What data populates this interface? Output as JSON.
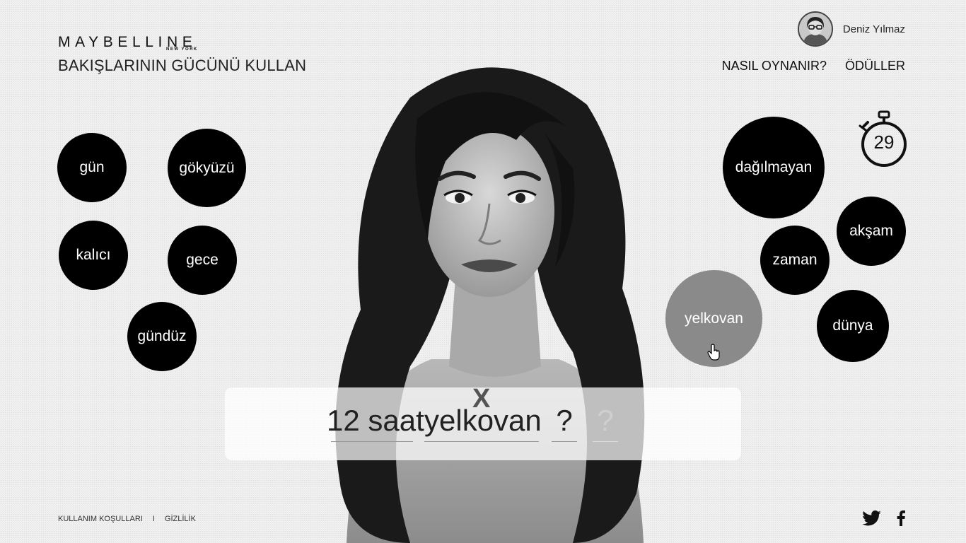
{
  "header": {
    "brand": "MAYBELLINE",
    "brand_sub": "NEW YORK",
    "tagline": "BAKIŞLARININ GÜCÜNÜ KULLAN"
  },
  "user": {
    "name": "Deniz Yılmaz",
    "avatar_icon": "user-avatar"
  },
  "nav": {
    "how_to_play": "NASIL OYNANIR?",
    "rewards": "ÖDÜLLER"
  },
  "timer": {
    "seconds": "29",
    "icon": "stopwatch-icon"
  },
  "word_bubbles_left": [
    "gün",
    "gökyüzü",
    "kalıcı",
    "gece",
    "gündüz"
  ],
  "word_bubbles_right": [
    "dağılmayan",
    "akşam",
    "zaman",
    "yelkovan",
    "dünya"
  ],
  "selected_word": "yelkovan",
  "answer": {
    "clear_label": "X",
    "slots": [
      "12 saat",
      "yelkovan",
      "?",
      "?"
    ]
  },
  "footer": {
    "terms": "KULLANIM KOŞULLARI",
    "separator": "I",
    "privacy": "GİZLİLİK"
  },
  "social": {
    "twitter_icon": "twitter-icon",
    "facebook_icon": "facebook-icon"
  },
  "colors": {
    "bubble": "#000000",
    "bubble_active": "#8a8a8a",
    "background": "#efefef"
  }
}
